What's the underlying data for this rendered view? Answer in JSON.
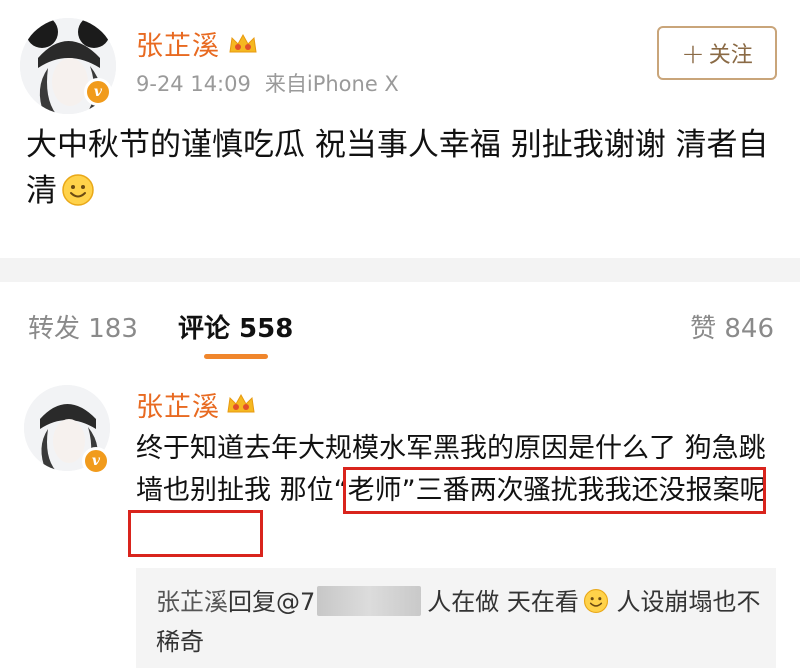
{
  "post": {
    "username": "张芷溪",
    "time": "9-24 14:09",
    "source": "来自iPhone X",
    "follow_label": "关注",
    "follow_plus": "+",
    "text": "大中秋节的谨慎吃瓜 祝当事人幸福 别扯我谢谢 清者自清",
    "emoji": "smile-emoji"
  },
  "tabs": {
    "repost": "转发 183",
    "comments": "评论 558",
    "likes": "赞 846"
  },
  "comment": {
    "username": "张芷溪",
    "text_before": "终于知道去年大规模水军黑我的原因是什么了 狗急跳墙也别扯我 ",
    "text_highlight": "那位“老师”三番两次骚扰我我还没报案呢",
    "reply": {
      "name": "张芷溪",
      "prefix": "回复@",
      "partial": "7",
      "text": "人在做 天在看",
      "text_after": " 人设崩塌也不稀奇"
    }
  },
  "colors": {
    "username": "#e86a21",
    "highlight_box": "#d9241d",
    "tab_underline": "#f0862c",
    "badge": "#f19b1c"
  }
}
